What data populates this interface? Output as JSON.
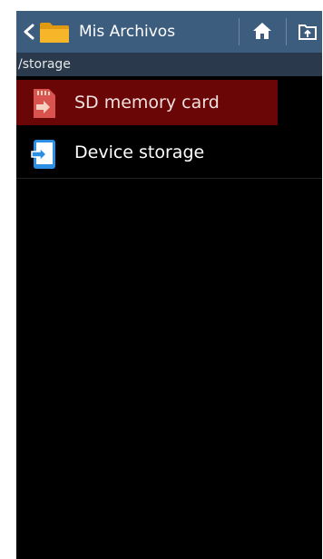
{
  "header": {
    "title": "Mis Archivos",
    "back_icon": "chevron-left-icon",
    "folder_icon": "folder-icon",
    "home_icon": "home-icon",
    "upload_icon": "folder-up-icon"
  },
  "path": {
    "current": "/storage"
  },
  "storage_items": [
    {
      "label": "SD memory card",
      "icon": "sd-card-icon",
      "selected": true
    },
    {
      "label": "Device storage",
      "icon": "device-storage-icon",
      "selected": false
    }
  ],
  "colors": {
    "action_bar": "#3d5d7e",
    "path_bar": "#2a3a4c",
    "selected_row": "#6b0606",
    "background": "#000000",
    "folder": "#f4b324"
  }
}
